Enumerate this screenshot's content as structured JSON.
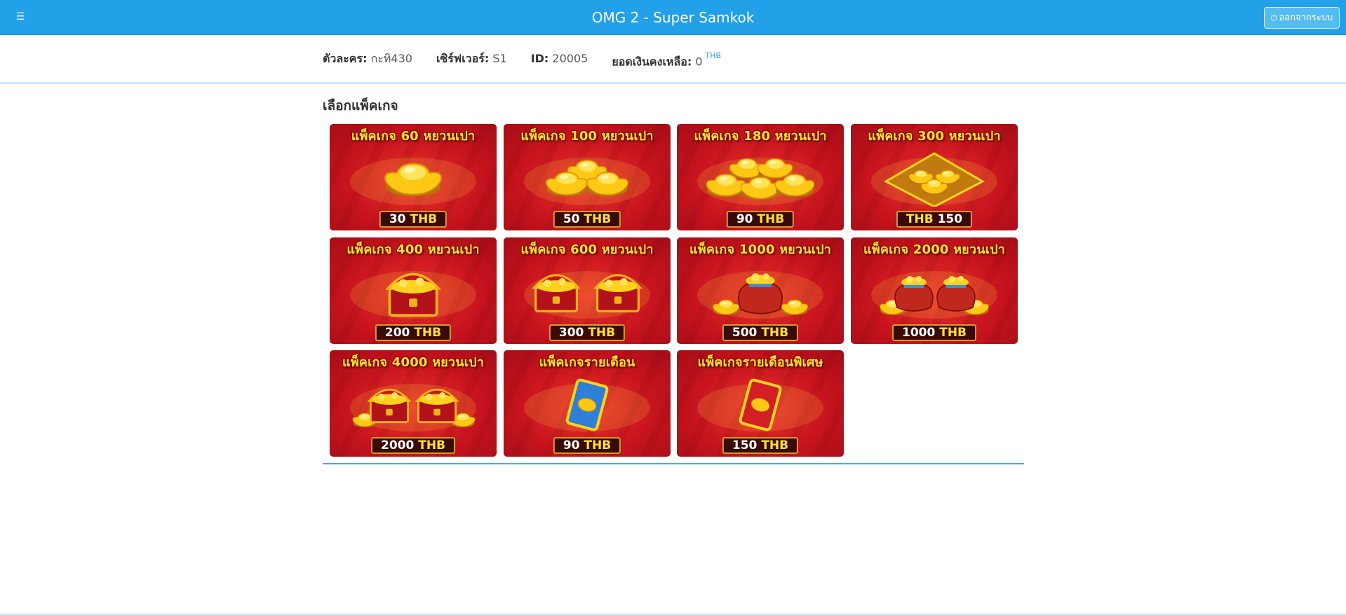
{
  "header": {
    "menu_icon": "menu-icon",
    "title": "OMG 2 - Super Samkok",
    "logout_label": "ออกจากระบบ",
    "logout_icon": "logout-icon"
  },
  "info": {
    "character_label": "ตัวละคร:",
    "character_value": "กะทิ430",
    "server_label": "เซิร์ฟเวอร์:",
    "server_value": "S1",
    "id_label": "ID:",
    "id_value": "20005",
    "balance_label": "ยอดเงินคงเหลือ:",
    "balance_value": "0",
    "balance_currency": "THB"
  },
  "section_title": "เลือกแพ็คเกจ",
  "packages": [
    {
      "title": "แพ็คเกจ 60 หยวนเปา",
      "amount": "30",
      "currency": "THB",
      "art": "ingot-single-icon"
    },
    {
      "title": "แพ็คเกจ 100 หยวนเปา",
      "amount": "50",
      "currency": "THB",
      "art": "ingot-trio-icon"
    },
    {
      "title": "แพ็คเกจ 180 หยวนเปา",
      "amount": "90",
      "currency": "THB",
      "art": "ingot-pile-icon"
    },
    {
      "title": "แพ็คเกจ 300 หยวนเปา",
      "amount": "150",
      "currency": "THB",
      "art": "ingot-tray-icon",
      "currency_first": true
    },
    {
      "title": "แพ็คเกจ 400 หยวนเปา",
      "amount": "200",
      "currency": "THB",
      "art": "treasure-chest-icon"
    },
    {
      "title": "แพ็คเกจ 600 หยวนเปา",
      "amount": "300",
      "currency": "THB",
      "art": "treasure-chests-icon"
    },
    {
      "title": "แพ็คเกจ 1000 หยวนเปา",
      "amount": "500",
      "currency": "THB",
      "art": "treasure-bag-icon"
    },
    {
      "title": "แพ็คเกจ 2000 หยวนเปา",
      "amount": "1000",
      "currency": "THB",
      "art": "treasure-bags-icon"
    },
    {
      "title": "แพ็คเกจ 4000 หยวนเปา",
      "amount": "2000",
      "currency": "THB",
      "art": "treasure-hoard-icon"
    },
    {
      "title": "แพ็คเกจรายเดือน",
      "amount": "90",
      "currency": "THB",
      "art": "monthly-card-blue-icon"
    },
    {
      "title": "แพ็คเกจรายเดือนพิเศษ",
      "amount": "150",
      "currency": "THB",
      "art": "monthly-card-red-icon"
    }
  ],
  "colors": {
    "header_bg": "#22a0e8",
    "card_red": "#c8141e",
    "gold": "#ffd21f",
    "price_accent": "#ffe033"
  }
}
